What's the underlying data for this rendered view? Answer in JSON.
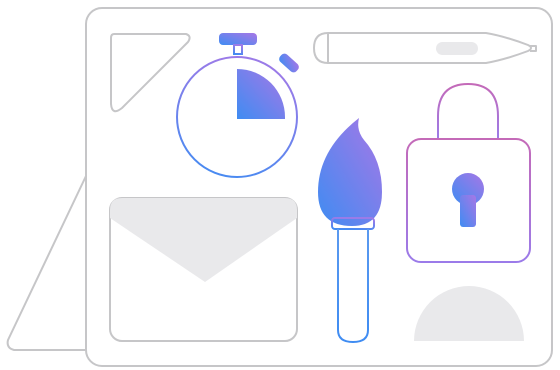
{
  "colors": {
    "outline": "#c6c6c8",
    "fill_light": "#e9e9eb",
    "grad_blue": "#3f8cf2",
    "grad_purple": "#a777e6",
    "grad_pink": "#c46ab8"
  },
  "icons": [
    "tablet-stand-icon",
    "triangle-ruler-icon",
    "stopwatch-icon",
    "pencil-icon",
    "paintbrush-icon",
    "padlock-icon",
    "envelope-icon",
    "semicircle-shape-icon"
  ]
}
